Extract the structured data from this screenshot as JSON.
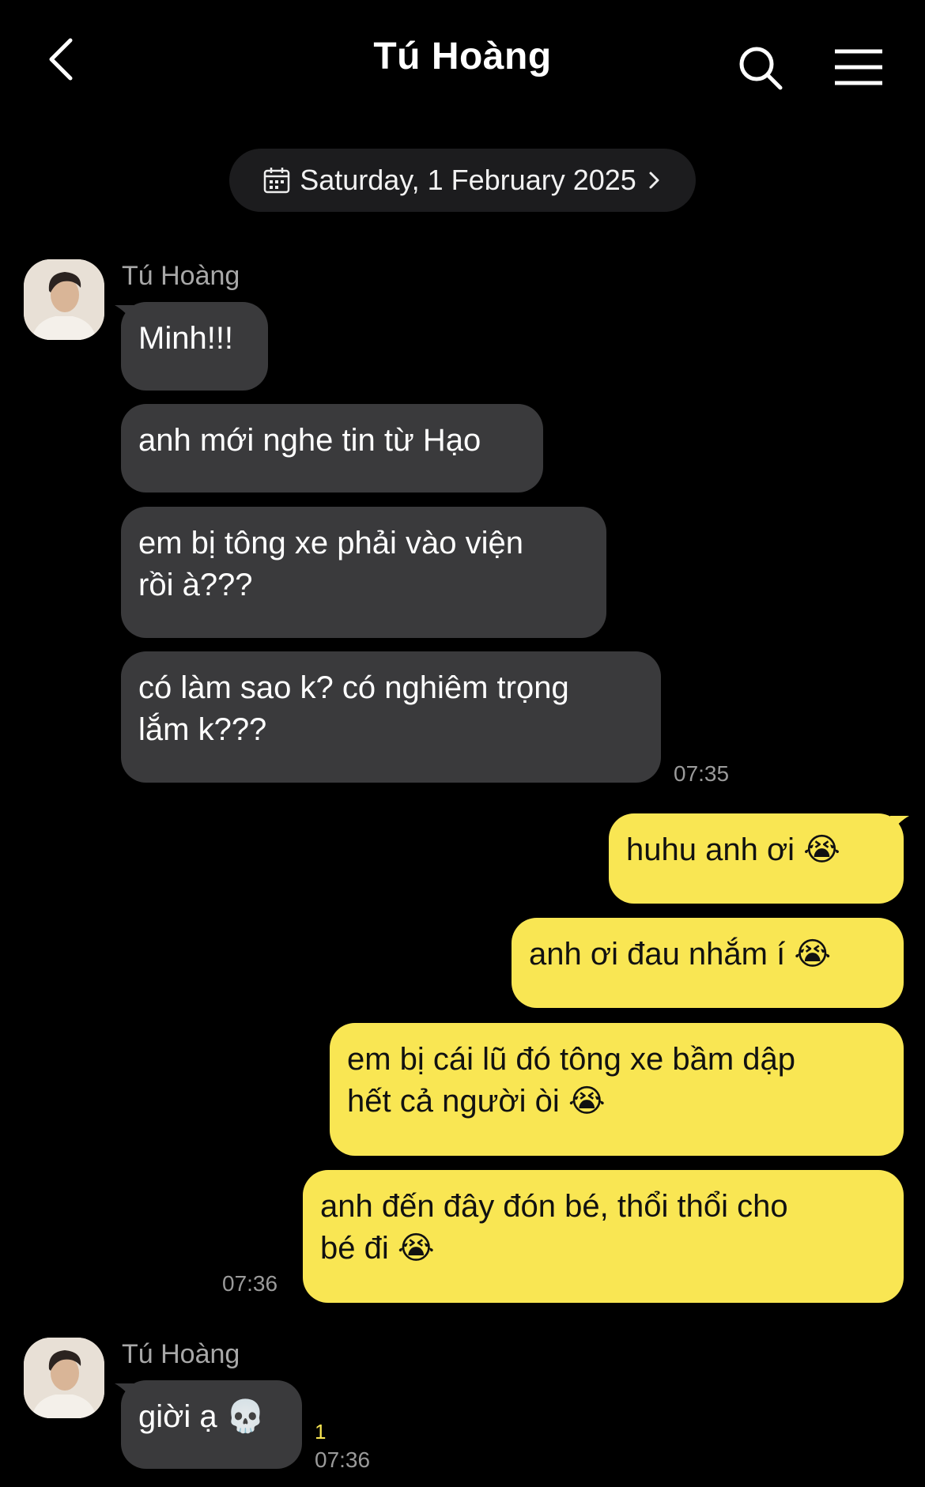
{
  "header": {
    "title": "Tú Hoàng",
    "back_icon": "chevron-left-icon",
    "search_icon": "search-icon",
    "menu_icon": "hamburger-menu-icon"
  },
  "date_divider": {
    "label": "Saturday, 1 February 2025",
    "icon": "calendar-icon"
  },
  "colors": {
    "background": "#000000",
    "incoming_bubble": "#3a3a3c",
    "outgoing_bubble": "#f9e653",
    "unread_count": "#f9e653"
  },
  "messages": {
    "group1": {
      "sender": "Tú Hoàng",
      "m1": "Minh!!!",
      "m2": "anh mới nghe tin từ Hạo",
      "m3": "em bị tông xe phải vào viện\nrồi à???",
      "m4": "có làm sao k? có nghiêm trọng\nlắm k???",
      "time": "07:35"
    },
    "group2": {
      "m1": "huhu anh ơi 😭",
      "m2": "anh ơi đau nhắm í 😭",
      "m3": "em bị cái lũ đó tông xe bầm dập\nhết cả người òi 😭",
      "m4": "anh đến đây đón bé, thổi thổi cho\nbé đi 😭",
      "time": "07:36"
    },
    "group3": {
      "sender": "Tú Hoàng",
      "m1": "giời ạ 💀",
      "unread": "1",
      "time": "07:36"
    }
  }
}
